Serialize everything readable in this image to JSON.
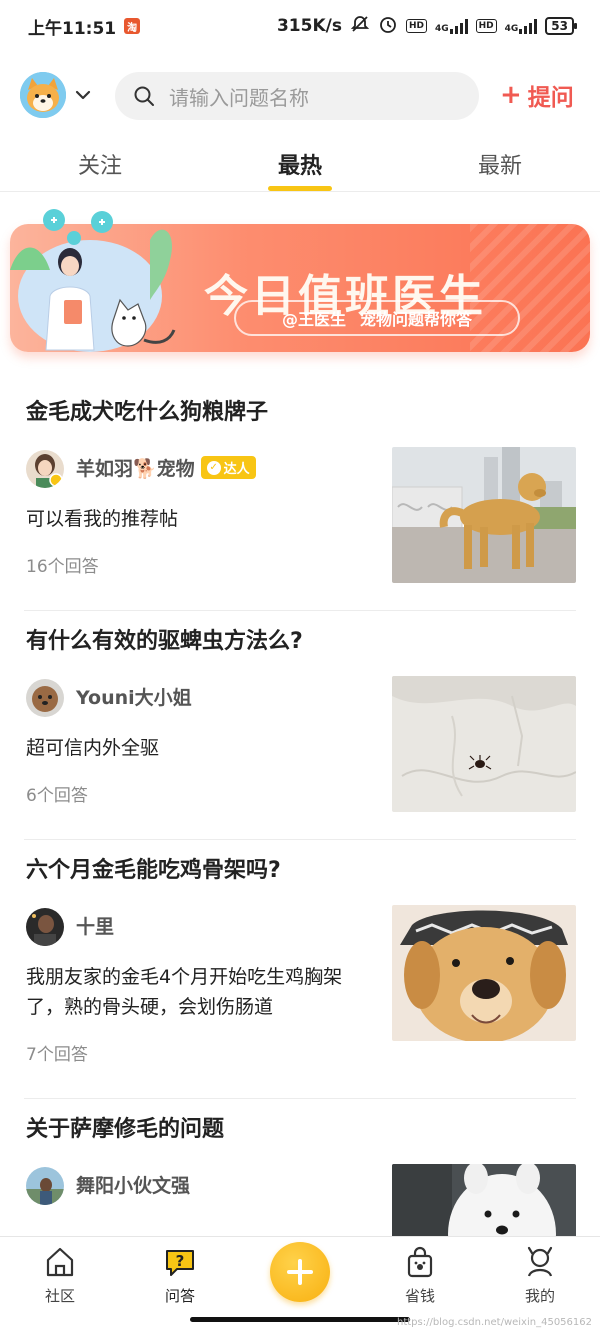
{
  "status_bar": {
    "time": "上午11:51",
    "app_indicator": "淘",
    "net_speed": "315K/s",
    "hd1": "HD",
    "net1": "4G",
    "hd2": "HD",
    "net2": "4G",
    "battery": "53"
  },
  "header": {
    "search_placeholder": "请输入问题名称",
    "ask_label": "提问",
    "ask_plus": "+"
  },
  "tabs": [
    {
      "label": "关注",
      "active": false
    },
    {
      "label": "最热",
      "active": true
    },
    {
      "label": "最新",
      "active": false
    }
  ],
  "banner": {
    "title": "今日值班医生",
    "subtitle_doctor": "@王医生",
    "subtitle_text": "宠物问题帮你答"
  },
  "questions": [
    {
      "title": "金毛成犬吃什么狗粮牌子",
      "user": "羊如羽🐕宠物",
      "badge": "达人",
      "desc": "可以看我的推荐帖",
      "answers": "16个回答"
    },
    {
      "title": "有什么有效的驱蜱虫方法么?",
      "user": "Youni大小姐",
      "desc": "超可信内外全驱",
      "answers": "6个回答"
    },
    {
      "title": "六个月金毛能吃鸡骨架吗?",
      "user": "十里",
      "desc": "我朋友家的金毛4个月开始吃生鸡胸架了，熟的骨头硬，会划伤肠道",
      "answers": "7个回答"
    },
    {
      "title": "关于萨摩修毛的问题",
      "user": "舞阳小伙文强"
    }
  ],
  "bottom_nav": {
    "community": "社区",
    "qa": "问答",
    "save": "省钱",
    "mine": "我的"
  },
  "watermark": "https://blog.csdn.net/weixin_45056162",
  "colors": {
    "accent_yellow": "#f8c514",
    "ask_red": "#f05a52",
    "banner_orange": "#fb7353"
  }
}
